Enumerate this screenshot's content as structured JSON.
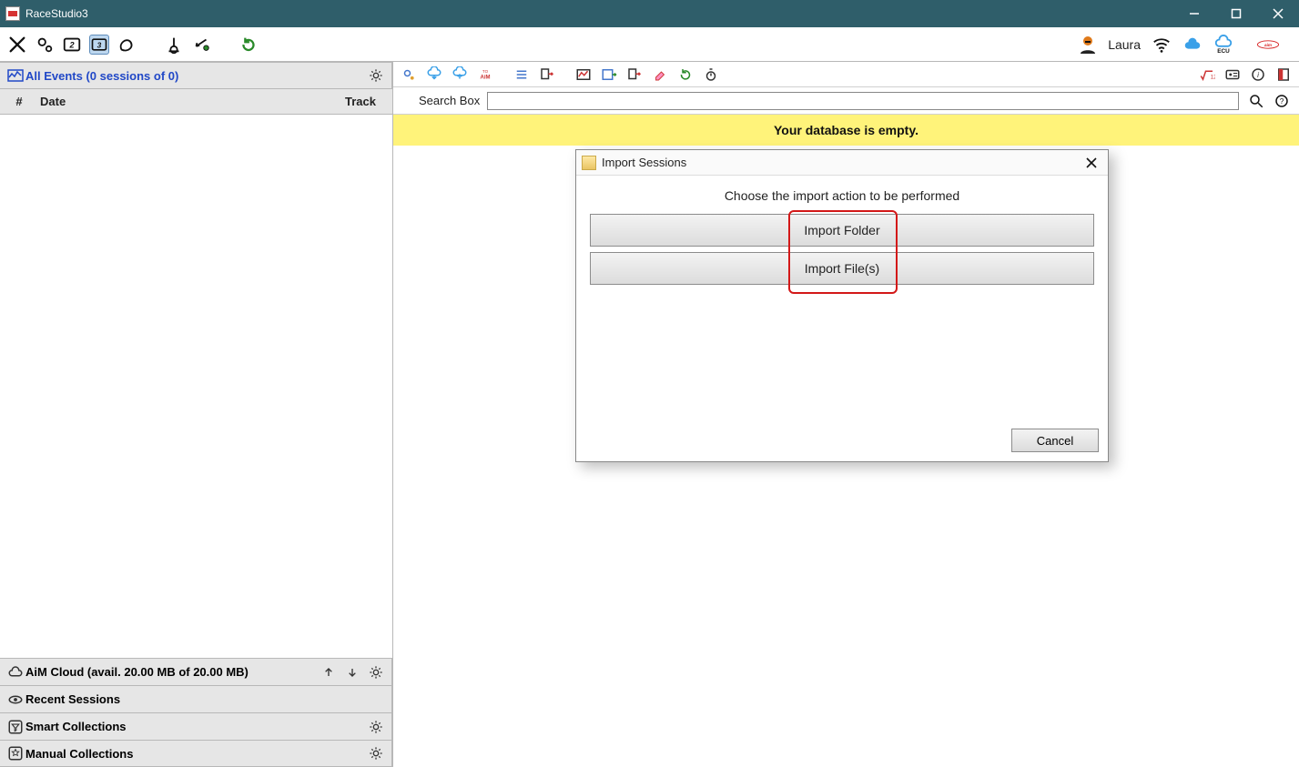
{
  "app": {
    "title": "RaceStudio3"
  },
  "user": {
    "name": "Laura"
  },
  "sidebar": {
    "all_events": "All Events (0 sessions of 0)",
    "columns": {
      "num": "#",
      "date": "Date",
      "track": "Track"
    },
    "cloud": "AiM Cloud (avail. 20.00 MB of 20.00 MB)",
    "recent": "Recent Sessions",
    "smart": "Smart Collections",
    "manual": "Manual Collections"
  },
  "main": {
    "search_label": "Search Box",
    "search_value": "",
    "empty_msg": "Your database is empty."
  },
  "dialog": {
    "title": "Import Sessions",
    "prompt": "Choose the import action to be performed",
    "btn_folder": "Import Folder",
    "btn_files": "Import File(s)",
    "cancel": "Cancel"
  }
}
